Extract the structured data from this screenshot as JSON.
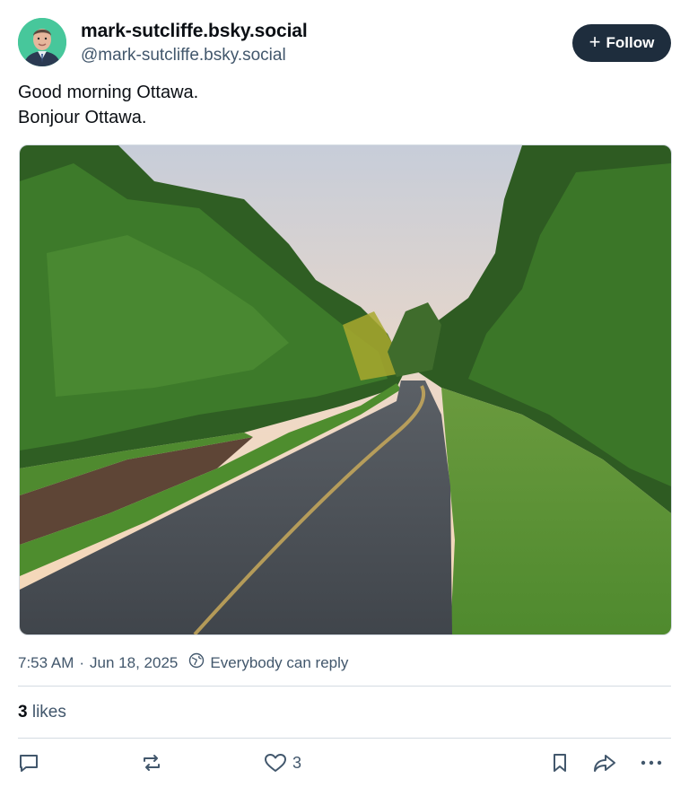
{
  "author": {
    "display_name": "mark-sutcliffe.bsky.social",
    "handle": "@mark-sutcliffe.bsky.social"
  },
  "follow_button": {
    "label": "Follow"
  },
  "post": {
    "lines": [
      "Good morning Ottawa.",
      "Bonjour Ottawa."
    ]
  },
  "meta": {
    "time": "7:53 AM",
    "separator": "·",
    "date": "Jun 18, 2025",
    "reply_setting": "Everybody can reply"
  },
  "stats": {
    "likes_count": "3",
    "likes_label": "likes"
  },
  "actions": {
    "reply_icon": "speech-bubble-icon",
    "repost_icon": "repost-icon",
    "like_icon": "heart-icon",
    "like_count": "3",
    "bookmark_icon": "bookmark-icon",
    "share_icon": "share-arrow-icon",
    "more_icon": "ellipsis-icon"
  },
  "colors": {
    "follow_bg": "#1e2d3d",
    "secondary_text": "#42576c",
    "divider": "#d4dbe2"
  }
}
